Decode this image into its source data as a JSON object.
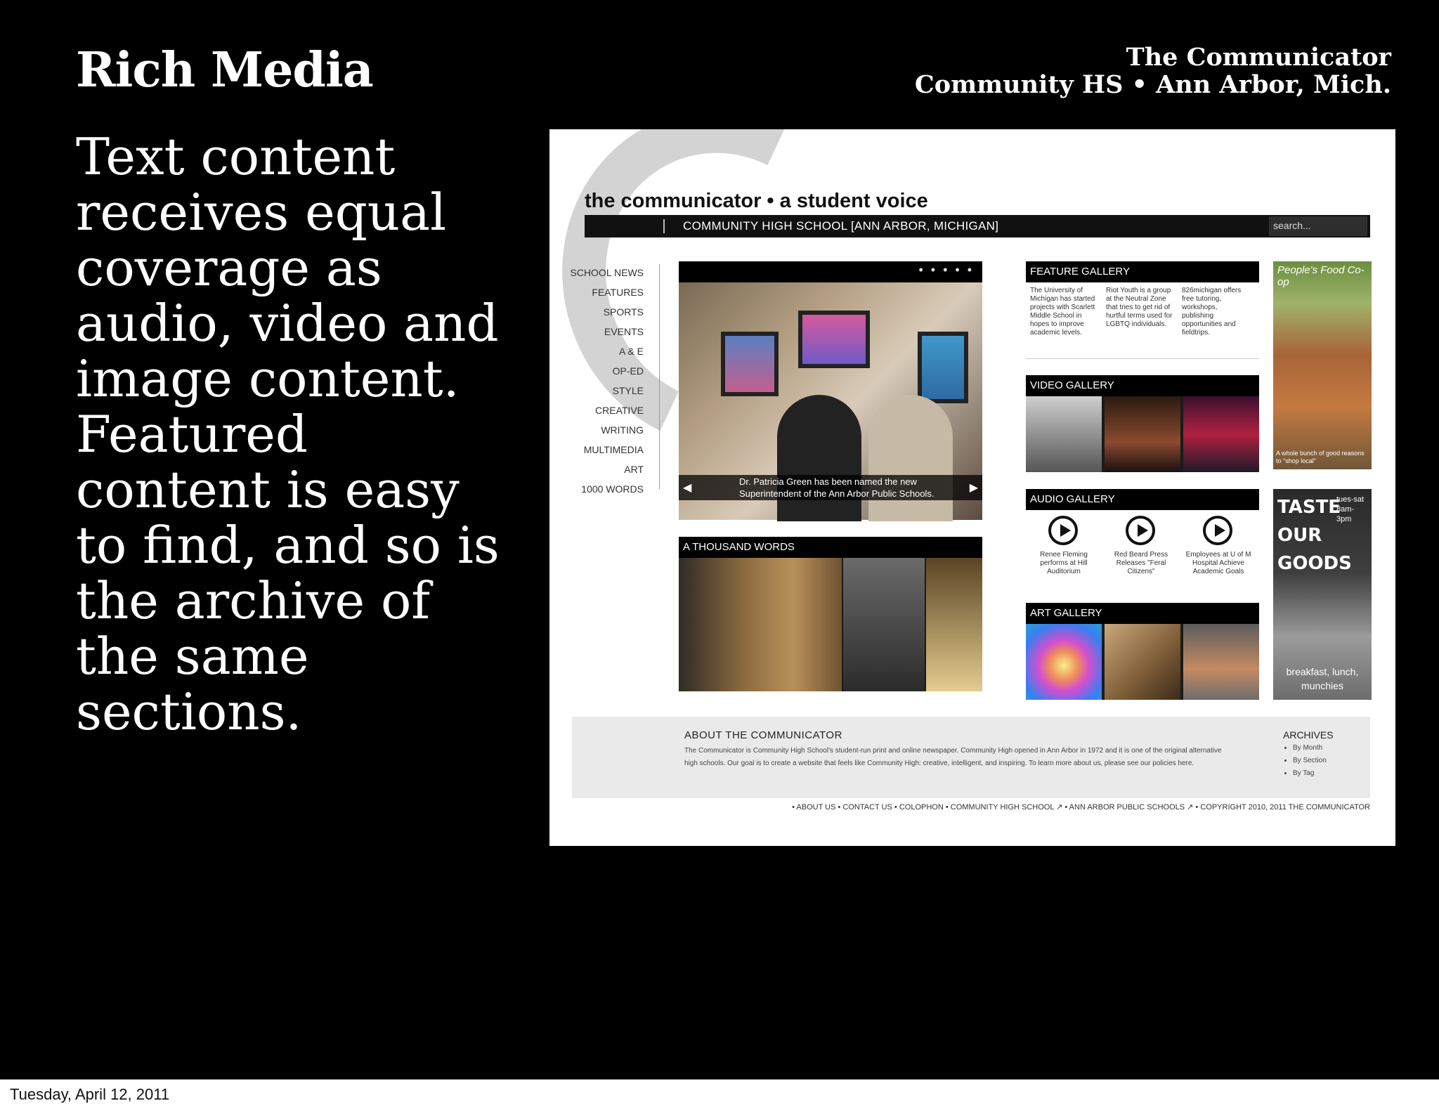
{
  "slide": {
    "title": "Rich Media",
    "publication": {
      "line1": "The Communicator",
      "line2": "Community HS • Ann Arbor, Mich."
    },
    "body": "Text content receives equal coverage as audio, video and image content. Featured content is easy to find, and so is the archive of the same sections."
  },
  "site": {
    "title": "the communicator • a student voice",
    "school": "COMMUNITY HIGH SCHOOL [ANN ARBOR, MICHIGAN]",
    "search_placeholder": "search...",
    "nav": [
      "SCHOOL NEWS",
      "FEATURES",
      "SPORTS",
      "EVENTS",
      "A & E",
      "OP-ED",
      "STYLE",
      "CREATIVE",
      "WRITING",
      "MULTIMEDIA",
      "ART",
      "1000 WORDS"
    ],
    "hero": {
      "dots": "• • • • •",
      "caption": "Dr. Patricia Green has been named the new Superintendent of the Ann Arbor Public Schools."
    },
    "thousand_words": "A THOUSAND WORDS",
    "feature_gallery": {
      "title": "FEATURE GALLERY",
      "items": [
        "The University of Michigan has started projects with Scarlett Middle School in hopes to improve academic levels.",
        "Riot Youth is a group at the Neutral Zone that tries to get rid of hurtful terms used for LGBTQ individuals.",
        "826michigan offers free tutoring, workshops, publishing opportunities and fieldtrips."
      ]
    },
    "video_gallery": {
      "title": "VIDEO GALLERY"
    },
    "audio_gallery": {
      "title": "AUDIO GALLERY",
      "items": [
        "Renee Fleming performs at Hill Auditorium",
        "Red Beard Press Releases \"Feral Citizens\"",
        "Employees at U of M Hospital Achieve Academic Goals"
      ]
    },
    "art_gallery": {
      "title": "ART GALLERY"
    },
    "ads": {
      "coop": "People's Food Co-op",
      "coop_caption": "A whole bunch of good reasons to \"shop local\"",
      "taste": "TASTE OUR GOODS",
      "taste_hours": "tues-sat 8am-3pm",
      "taste_foot": "breakfast, lunch, munchies"
    },
    "about": {
      "title": "ABOUT THE COMMUNICATOR",
      "text": "The Communicator is Community High School's student-run print and online newspaper. Community High opened in Ann Arbor in 1972 and it is one of the original alternative high schools. Our goal is to create a website that feels like Community High: creative, intelligent, and inspiring. To learn more about us, please see our policies here."
    },
    "archives": {
      "title": "ARCHIVES",
      "items": [
        "By Month",
        "By Section",
        "By Tag"
      ]
    },
    "footer": "• ABOUT US • CONTACT US • COLOPHON • COMMUNITY HIGH SCHOOL ↗ • ANN ARBOR PUBLIC SCHOOLS ↗ • COPYRIGHT 2010, 2011 THE COMMUNICATOR"
  },
  "status_bar": {
    "date": "Tuesday, April 12, 2011"
  }
}
